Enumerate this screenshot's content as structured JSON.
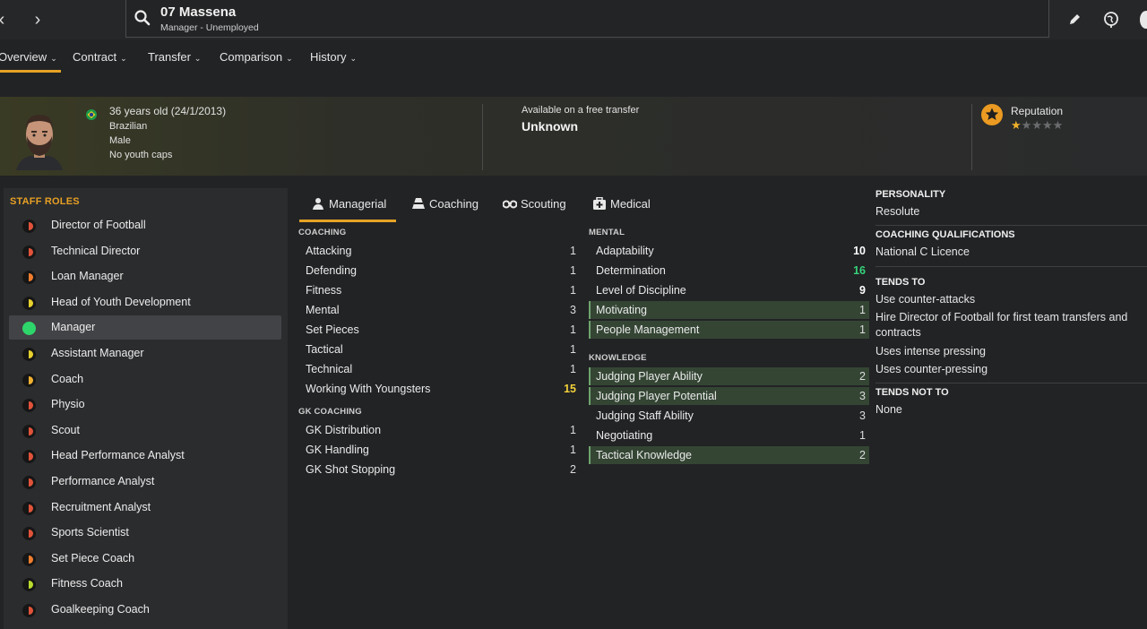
{
  "header": {
    "name": "07 Massena",
    "subtitle": "Manager - Unemployed"
  },
  "tabs": [
    {
      "label": "Overview"
    },
    {
      "label": "Contract"
    },
    {
      "label": "Transfer"
    },
    {
      "label": "Comparison"
    },
    {
      "label": "History"
    }
  ],
  "profile": {
    "age": "36 years old (24/1/2013)",
    "nationality": "Brazilian",
    "gender": "Male",
    "youth_caps": "No youth caps",
    "transfer_label": "Available on a free transfer",
    "transfer_value": "Unknown",
    "reputation_label": "Reputation",
    "reputation_stars": 1,
    "reputation_max": 5
  },
  "roles": {
    "title": "STAFF ROLES",
    "items": [
      {
        "label": "Director of Football",
        "color": "#e0533a",
        "level": "half"
      },
      {
        "label": "Technical Director",
        "color": "#e0533a",
        "level": "half"
      },
      {
        "label": "Loan Manager",
        "color": "#ee7d2e",
        "level": "half"
      },
      {
        "label": "Head of Youth Development",
        "color": "#e6d12e",
        "level": "half"
      },
      {
        "label": "Manager",
        "color": "#2ed56a",
        "level": "full",
        "selected": true
      },
      {
        "label": "Assistant Manager",
        "color": "#e6d12e",
        "level": "half"
      },
      {
        "label": "Coach",
        "color": "#f0b030",
        "level": "half"
      },
      {
        "label": "Physio",
        "color": "#e0533a",
        "level": "half"
      },
      {
        "label": "Scout",
        "color": "#e0533a",
        "level": "half"
      },
      {
        "label": "Head Performance Analyst",
        "color": "#e0533a",
        "level": "half"
      },
      {
        "label": "Performance Analyst",
        "color": "#e0533a",
        "level": "half"
      },
      {
        "label": "Recruitment Analyst",
        "color": "#e0533a",
        "level": "half"
      },
      {
        "label": "Sports Scientist",
        "color": "#e0533a",
        "level": "half"
      },
      {
        "label": "Set Piece Coach",
        "color": "#ee7d2e",
        "level": "half"
      },
      {
        "label": "Fitness Coach",
        "color": "#b8dc2e",
        "level": "half"
      },
      {
        "label": "Goalkeeping Coach",
        "color": "#e0533a",
        "level": "half"
      }
    ]
  },
  "attr_tabs": [
    {
      "label": "Managerial"
    },
    {
      "label": "Coaching"
    },
    {
      "label": "Scouting"
    },
    {
      "label": "Medical"
    }
  ],
  "coaching": {
    "title": "COACHING",
    "items": [
      {
        "name": "Attacking",
        "value": "1"
      },
      {
        "name": "Defending",
        "value": "1"
      },
      {
        "name": "Fitness",
        "value": "1"
      },
      {
        "name": "Mental",
        "value": "3"
      },
      {
        "name": "Set Pieces",
        "value": "1"
      },
      {
        "name": "Tactical",
        "value": "1"
      },
      {
        "name": "Technical",
        "value": "1"
      },
      {
        "name": "Working With Youngsters",
        "value": "15"
      }
    ]
  },
  "gk_coaching": {
    "title": "GK COACHING",
    "items": [
      {
        "name": "GK Distribution",
        "value": "1"
      },
      {
        "name": "GK Handling",
        "value": "1"
      },
      {
        "name": "GK Shot Stopping",
        "value": "2"
      }
    ]
  },
  "mental": {
    "title": "MENTAL",
    "items": [
      {
        "name": "Adaptability",
        "value": "10"
      },
      {
        "name": "Determination",
        "value": "16"
      },
      {
        "name": "Level of Discipline",
        "value": "9"
      },
      {
        "name": "Motivating",
        "value": "1"
      },
      {
        "name": "People Management",
        "value": "1"
      }
    ]
  },
  "knowledge": {
    "title": "KNOWLEDGE",
    "items": [
      {
        "name": "Judging Player Ability",
        "value": "2"
      },
      {
        "name": "Judging Player Potential",
        "value": "3"
      },
      {
        "name": "Judging Staff Ability",
        "value": "3"
      },
      {
        "name": "Negotiating",
        "value": "1"
      },
      {
        "name": "Tactical Knowledge",
        "value": "2"
      }
    ]
  },
  "info": {
    "personality_title": "PERSONALITY",
    "personality": "Resolute",
    "qualifications_title": "COACHING QUALIFICATIONS",
    "qualifications": "National C Licence",
    "tends_to_title": "TENDS TO",
    "tends_to": [
      "Use counter-attacks",
      "Hire Director of Football for first team transfers and contracts",
      "Uses intense pressing",
      "Uses counter-pressing"
    ],
    "tends_not_to_title": "TENDS NOT TO",
    "tends_not_to": "None"
  }
}
